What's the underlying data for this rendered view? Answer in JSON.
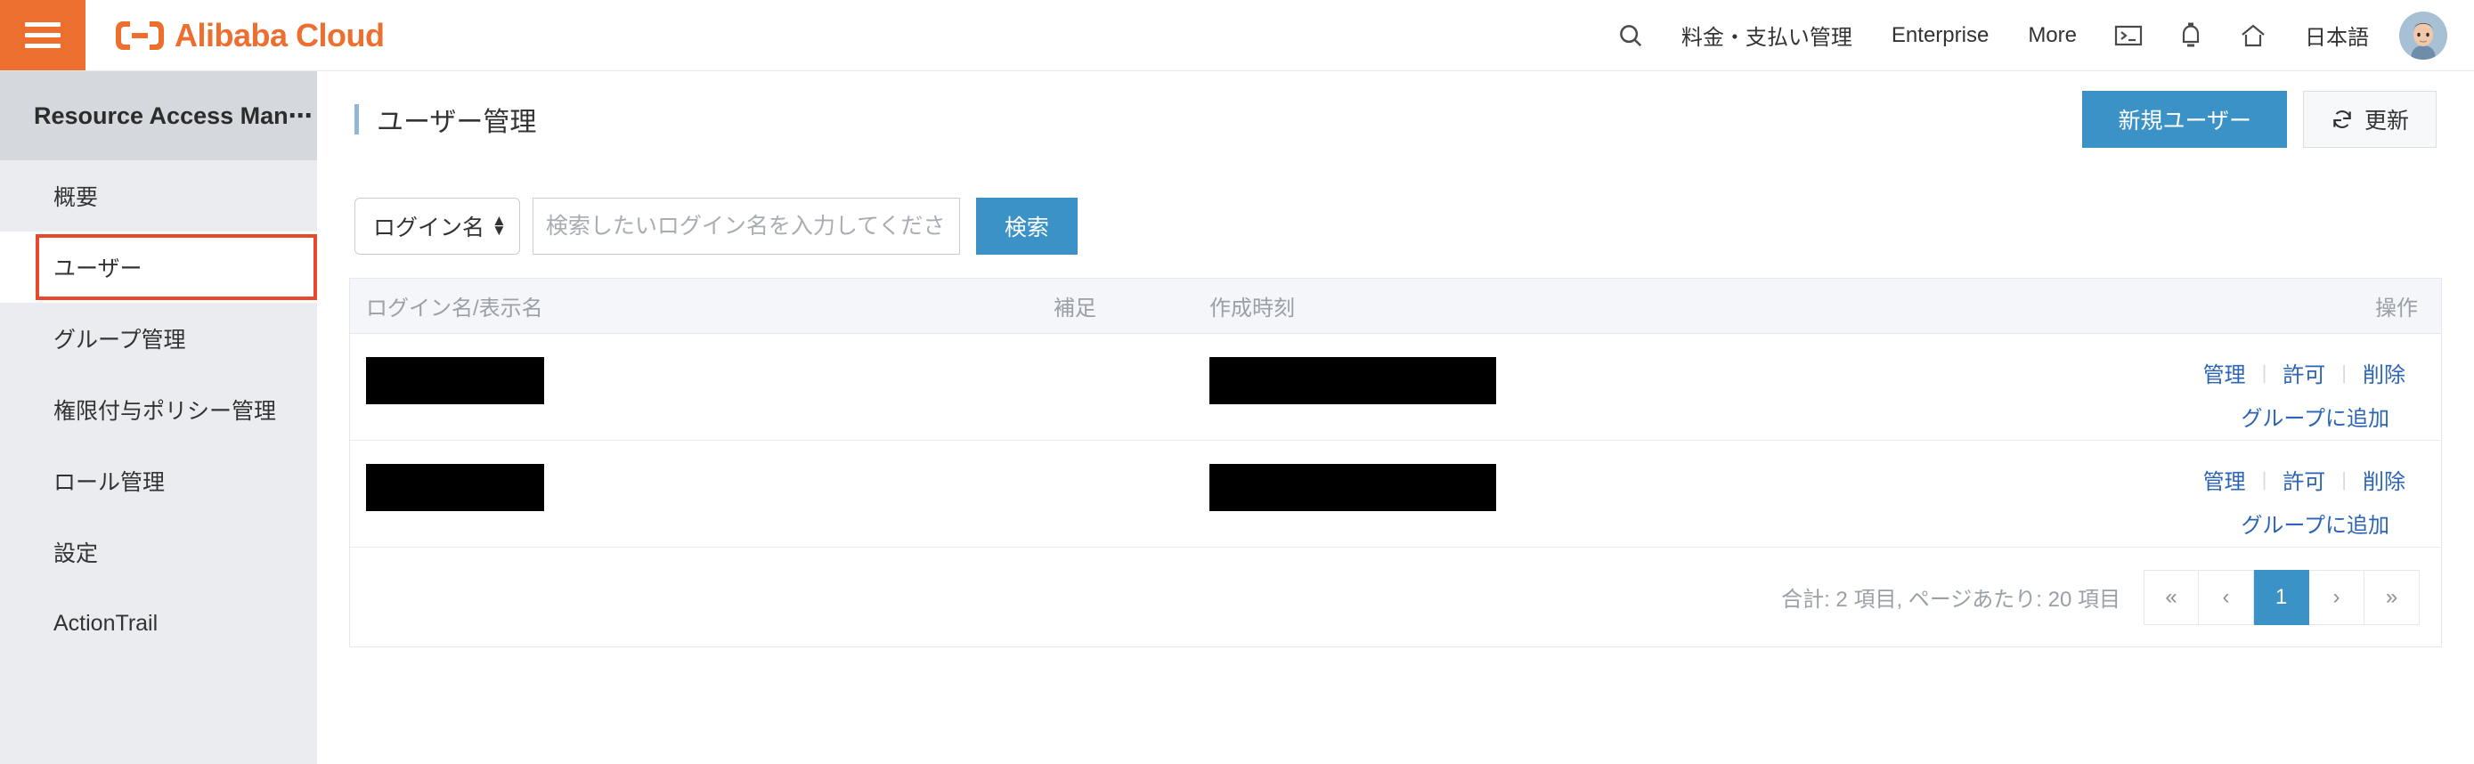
{
  "topbar": {
    "menu_icon": "hamburger-icon",
    "brand": "Alibaba Cloud",
    "nav": [
      {
        "label": "料金・支払い管理",
        "name": "topnav-billing"
      },
      {
        "label": "Enterprise",
        "name": "topnav-enterprise"
      },
      {
        "label": "More",
        "name": "topnav-more"
      }
    ],
    "search_icon": "search-icon",
    "terminal_icon": "terminal-icon",
    "bell_icon": "bell-icon",
    "home_icon": "home-icon",
    "language": "日本語",
    "avatar": "avatar"
  },
  "sidebar": {
    "title": "Resource Access Man⋯",
    "items": [
      {
        "label": "概要",
        "name": "sidebar-item-overview",
        "selected": false
      },
      {
        "label": "ユーザー",
        "name": "sidebar-item-users",
        "selected": true
      },
      {
        "label": "グループ管理",
        "name": "sidebar-item-groups",
        "selected": false
      },
      {
        "label": "権限付与ポリシー管理",
        "name": "sidebar-item-policies",
        "selected": false
      },
      {
        "label": "ロール管理",
        "name": "sidebar-item-roles",
        "selected": false
      },
      {
        "label": "設定",
        "name": "sidebar-item-settings",
        "selected": false
      },
      {
        "label": "ActionTrail",
        "name": "sidebar-item-actiontrail",
        "selected": false
      }
    ]
  },
  "page": {
    "title": "ユーザー管理",
    "accent_color": "#8fb8d8",
    "primary_color": "#3B92C6",
    "brand_color": "#ED6F2F",
    "highlight_color": "#E8482B",
    "create_user_label": "新規ユーザー",
    "refresh_label": "更新",
    "refresh_icon": "refresh-icon"
  },
  "filter": {
    "select_value": "ログイン名",
    "search_placeholder": "検索したいログイン名を入力してください",
    "search_value": "",
    "search_button": "検索"
  },
  "table": {
    "columns": [
      "ログイン名/表示名",
      "補足",
      "作成時刻",
      "操作"
    ],
    "rows": [
      {
        "login_name": "",
        "login_redacted": true,
        "note": "",
        "created_at": "",
        "created_redacted": true,
        "actions": [
          "管理",
          "許可",
          "削除"
        ],
        "action_secondary": "グループに追加"
      },
      {
        "login_name": "",
        "login_redacted": true,
        "note": "",
        "created_at": "",
        "created_redacted": true,
        "actions": [
          "管理",
          "許可",
          "削除"
        ],
        "action_secondary": "グループに追加"
      }
    ]
  },
  "footer": {
    "summary": "合計: 2 項目, ページあたり: 20 項目",
    "pager": [
      {
        "label": "«",
        "name": "pager-first",
        "active": false
      },
      {
        "label": "‹",
        "name": "pager-prev",
        "active": false
      },
      {
        "label": "1",
        "name": "pager-page-1",
        "active": true
      },
      {
        "label": "›",
        "name": "pager-next",
        "active": false
      },
      {
        "label": "»",
        "name": "pager-last",
        "active": false
      }
    ]
  }
}
